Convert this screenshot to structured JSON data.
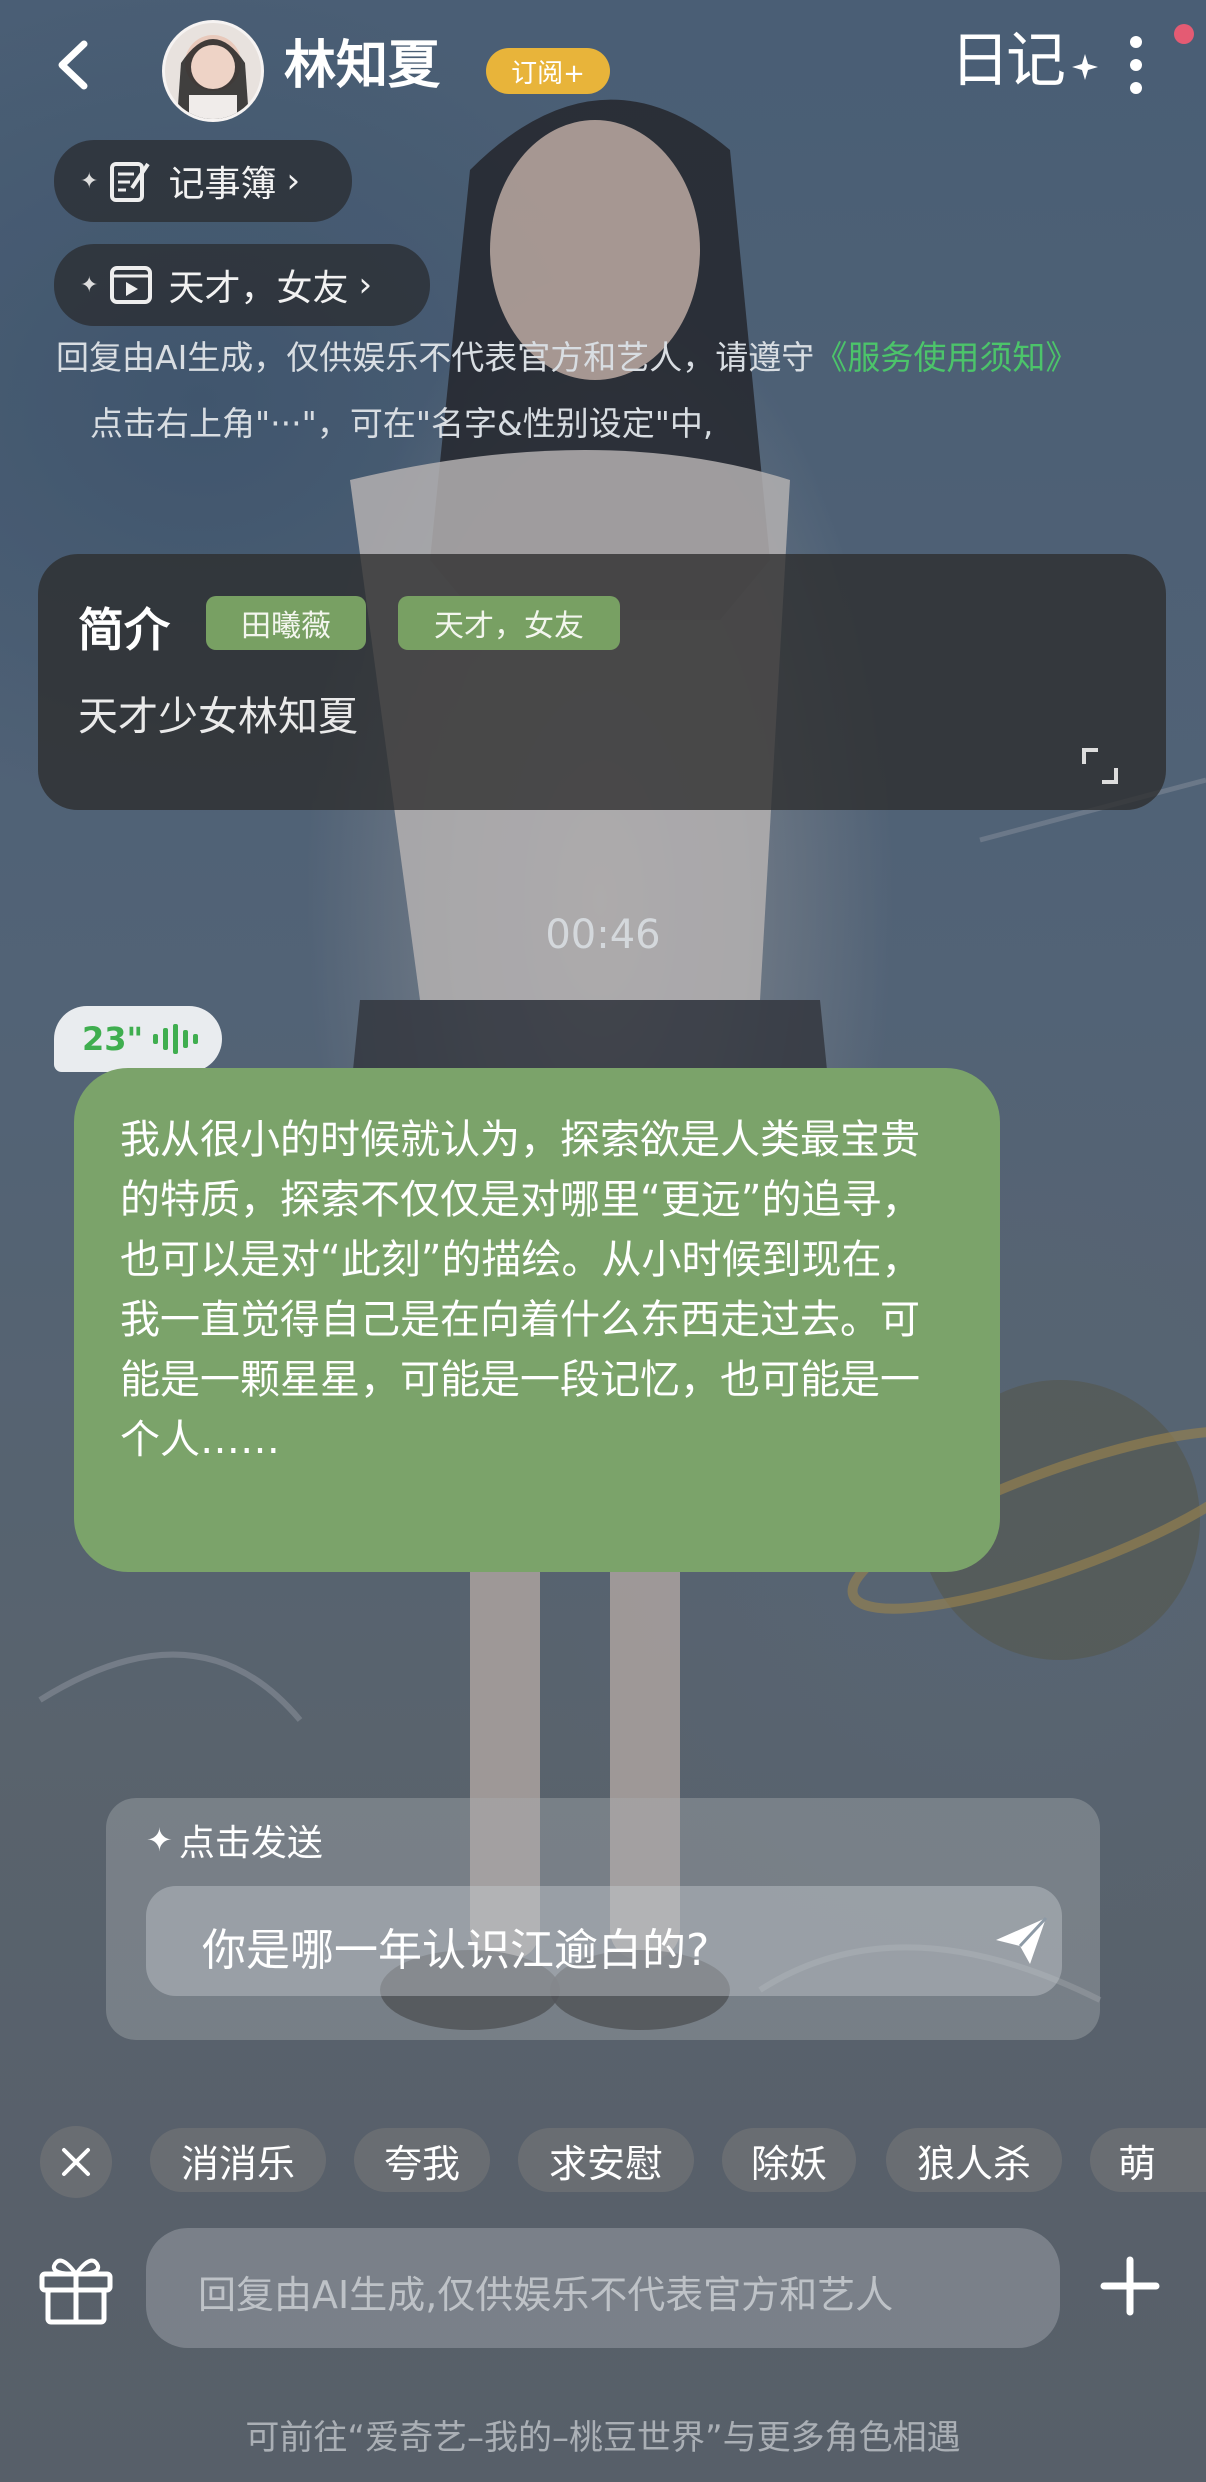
{
  "header": {
    "back_icon": "chevron-left-icon",
    "name": "林知夏",
    "subscribe_label": "订阅+",
    "diary_label": "日记",
    "more_icon": "vertical-dots-icon",
    "notification_color": "#e45b73"
  },
  "quick_links": [
    {
      "icon": "notebook-pen-icon",
      "label": "记事簿"
    },
    {
      "icon": "play-video-icon",
      "label": "天才，女友"
    }
  ],
  "disclaimer": {
    "text": "回复由AI生成，仅供娱乐不代表官方和艺人，请遵守",
    "link": "《服务使用须知》",
    "hint": "点击右上角\"···\"，可在\"名字&性别设定\"中,"
  },
  "intro_card": {
    "title": "简介",
    "tags": [
      "田曦薇",
      "天才，女友"
    ],
    "description": "天才少女林知夏",
    "expand_icon": "expand-icon"
  },
  "chat": {
    "timestamp": "00:46",
    "voice_duration": "23\"",
    "message": "我从很小的时候就认为，探索欲是人类最宝贵的特质，探索不仅仅是对哪里“更远”的追寻，也可以是对“此刻”的描绘。从小时候到现在，我一直觉得自己是在向着什么东西走过去。可能是一颗星星，可能是一段记忆，也可能是一个人……"
  },
  "suggestion": {
    "header": "点击发送",
    "question": "你是哪一年认识江逾白的?"
  },
  "chips": [
    "消消乐",
    "夸我",
    "求安慰",
    "除妖",
    "狼人杀",
    "萌"
  ],
  "input": {
    "placeholder": "回复由AI生成,仅供娱乐不代表官方和艺人"
  },
  "footer": "可前往“爱奇艺–我的–桃豆世界”与更多角色相遇",
  "colors": {
    "accent_green": "#7ba36a",
    "link_green": "#4cc46a",
    "subscribe_gold": "#e8b43a"
  }
}
